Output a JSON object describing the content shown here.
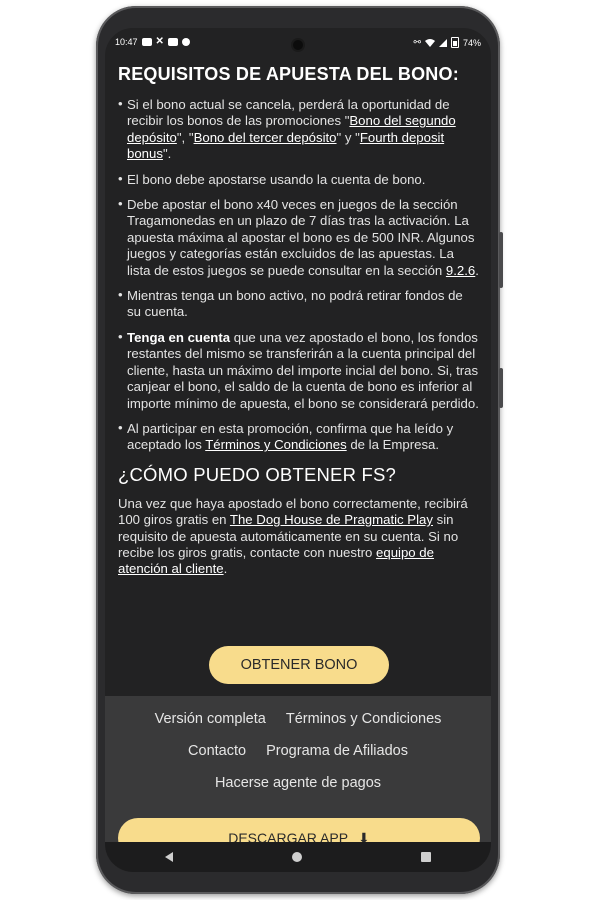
{
  "status_bar": {
    "time": "10:47",
    "battery": "74%",
    "icons": [
      "youtube-icon",
      "x-icon",
      "youtube-icon",
      "motorola-icon",
      "link-icon",
      "wifi-icon",
      "signal-icon",
      "battery-icon"
    ]
  },
  "section1": {
    "title": "REQUISITOS DE APUESTA DEL BONO:",
    "items": [
      {
        "t1": "Si el bono actual se cancela, perderá la oportunidad de recibir los bonos de las promociones \"",
        "l1": "Bono del segundo depósito",
        "t2": "\", \"",
        "l2": "Bono del tercer depósito",
        "t3": "\" y \"",
        "l3": "Fourth deposit bonus",
        "t4": "\"."
      },
      {
        "text": "El bono debe apostarse usando la cuenta de bono."
      },
      {
        "text": "Debe apostar el bono x40 veces en juegos de la sección Tragamonedas en un plazo de 7 días tras la activación. La apuesta máxima al apostar el bono es de 500 INR. Algunos juegos y categorías están excluidos de las apuestas. La lista de estos juegos se puede consultar en la sección ",
        "link": "9.2.6",
        "end": "."
      },
      {
        "text": "Mientras tenga un bono activo, no podrá retirar fondos de su cuenta."
      },
      {
        "bold": "Tenga en cuenta",
        "text": " que una vez apostado el bono, los fondos restantes del mismo se transferirán a la cuenta principal del cliente, hasta un máximo del importe incial del bono. Si, tras canjear el bono, el saldo de la cuenta de bono es inferior al importe mínimo de apuesta, el bono se considerará perdido."
      },
      {
        "text": "Al participar en esta promoción, confirma que ha leído y aceptado los ",
        "link": "Términos y Condiciones",
        "end": " de la Empresa."
      }
    ]
  },
  "section2": {
    "title": "¿CÓMO PUEDO OBTENER FS?",
    "t1": "Una vez que haya apostado el bono correctamente, recibirá 100 giros gratis en ",
    "l1": "The Dog House de Pragmatic Play",
    "t2": " sin requisito de apuesta automáticamente en su cuenta. Si no recibe los giros gratis, contacte con nuestro ",
    "l2": "equipo de atención al cliente",
    "t3": "."
  },
  "buttons": {
    "get_bonus": "OBTENER BONO",
    "download_app": "DESCARGAR APP"
  },
  "footer": {
    "full_version": "Versión completa",
    "terms": "Términos y Condiciones",
    "contact": "Contacto",
    "affiliates": "Programa de Afiliados",
    "payment_agent": "Hacerse agente de pagos"
  },
  "colors": {
    "accent": "#f8dc8c",
    "background": "#222223",
    "footer_bg": "#3a3a3b"
  }
}
